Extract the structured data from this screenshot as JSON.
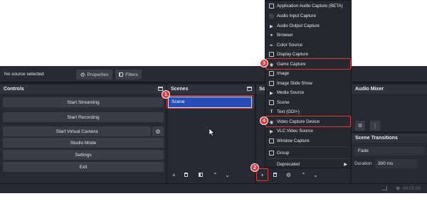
{
  "topbar": {
    "source_status": "No source selected",
    "properties_label": "Properties",
    "filters_label": "Filters"
  },
  "controls": {
    "title": "Controls",
    "start_streaming": "Start Streaming",
    "start_recording": "Start Recording",
    "start_virtual_camera": "Start Virtual Camera",
    "studio_mode": "Studio Mode",
    "settings": "Settings",
    "exit": "Exit"
  },
  "scenes": {
    "title": "Scenes",
    "items": [
      "Scene"
    ]
  },
  "sources": {
    "title": "Sou"
  },
  "audio_mixer": {
    "title": "Audio Mixer"
  },
  "scene_transitions": {
    "title": "Scene Transitions",
    "transition": "Fade",
    "duration_label": "Duration",
    "duration_value": "300 ms"
  },
  "add_source_menu": {
    "items": [
      {
        "label": "Application Audio Capture (BETA)",
        "icon": "app-audio-icon"
      },
      {
        "label": "Audio Input Capture",
        "icon": "microphone-icon"
      },
      {
        "label": "Audio Output Capture",
        "icon": "speaker-icon"
      },
      {
        "label": "Browser",
        "icon": "globe-icon"
      },
      {
        "label": "Color Source",
        "icon": "paint-brush-icon"
      },
      {
        "label": "Display Capture",
        "icon": "monitor-icon"
      },
      {
        "label": "Game Capture",
        "icon": "gamepad-icon"
      },
      {
        "label": "Image",
        "icon": "image-icon"
      },
      {
        "label": "Image Slide Show",
        "icon": "slideshow-icon"
      },
      {
        "label": "Media Source",
        "icon": "play-icon"
      },
      {
        "label": "Scene",
        "icon": "scene-icon"
      },
      {
        "label": "Text (GDI+)",
        "icon": "text-icon"
      },
      {
        "label": "Video Capture Device",
        "icon": "camera-icon"
      },
      {
        "label": "VLC Video Source",
        "icon": "play-icon"
      },
      {
        "label": "Window Capture",
        "icon": "window-icon"
      },
      {
        "label": "Group",
        "icon": "folder-icon"
      },
      {
        "label": "Deprecated",
        "icon": ""
      }
    ]
  },
  "callouts": {
    "step1": "1",
    "step2": "2",
    "step3": "3",
    "step4": "4"
  },
  "status": {
    "time": "00:00:00"
  },
  "colors": {
    "highlight": "#e2373b",
    "selected_scene": "#284cb8"
  }
}
